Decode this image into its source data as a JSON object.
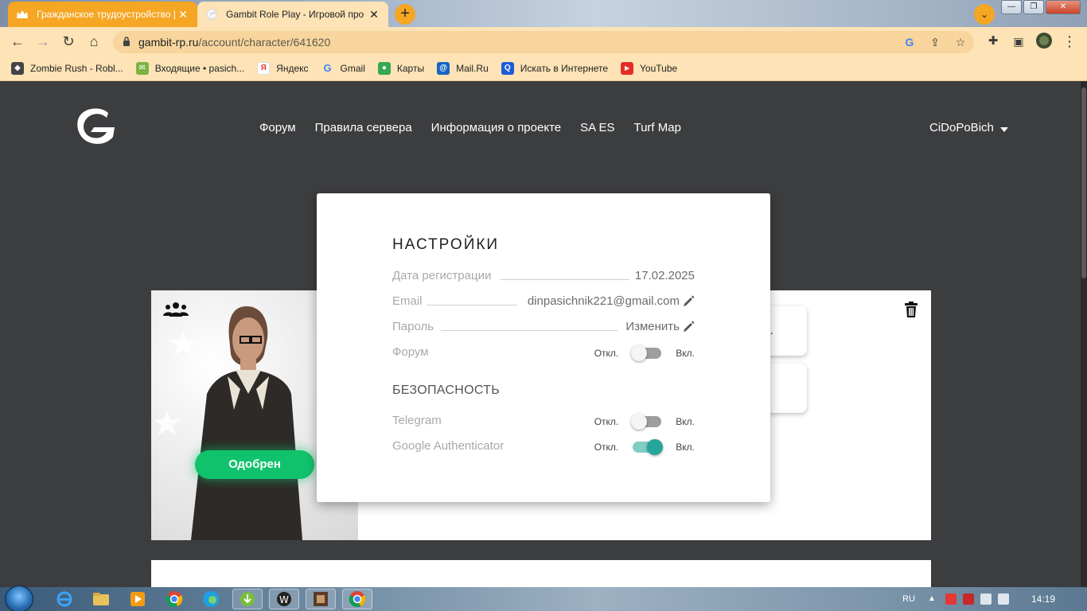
{
  "browser": {
    "tabs": [
      {
        "title": "Гражданское трудоустройство |",
        "active": false
      },
      {
        "title": "Gambit Role Play - Игровой про",
        "active": true
      }
    ],
    "new_tab_label": "+",
    "url_host": "gambit-rp.ru",
    "url_path": "/account/character/641620",
    "bookmarks": [
      {
        "label": "Zombie Rush - Robl...",
        "icon": "roblox-icon",
        "color": "#444444"
      },
      {
        "label": "Входящие • pasich...",
        "icon": "mail-envelope-icon",
        "color": "#7cb342"
      },
      {
        "label": "Яндекс",
        "icon": "yandex-icon",
        "color": "#e53935"
      },
      {
        "label": "Gmail",
        "icon": "google-icon",
        "color": "#4285f4"
      },
      {
        "label": "Карты",
        "icon": "maps-pin-icon",
        "color": "#34a853"
      },
      {
        "label": "Mail.Ru",
        "icon": "mailru-icon",
        "color": "#1565c0"
      },
      {
        "label": "Искать в Интернете",
        "icon": "search-icon",
        "color": "#1e5bd8"
      },
      {
        "label": "YouTube",
        "icon": "youtube-icon",
        "color": "#e52d27"
      }
    ]
  },
  "site": {
    "nav": [
      "Форум",
      "Правила сервера",
      "Информация о проекте",
      "SA ES",
      "Turf Map"
    ],
    "username": "CiDoPoBich"
  },
  "character": {
    "status": "Одобрен",
    "side_text": "l..."
  },
  "settings": {
    "title": "НАСТРОЙКИ",
    "registration": {
      "label": "Дата регистрации",
      "value": "17.02.2025"
    },
    "email": {
      "label": "Email",
      "value": "dinpasichnik221@gmail.com"
    },
    "password": {
      "label": "Пароль",
      "action": "Изменить"
    },
    "forum": {
      "label": "Форум",
      "off": "Откл.",
      "on": "Вкл.",
      "enabled": false
    },
    "security_title": "БЕЗОПАСНОСТЬ",
    "telegram": {
      "label": "Telegram",
      "off": "Откл.",
      "on": "Вкл.",
      "enabled": false
    },
    "google_auth": {
      "label": "Google Authenticator",
      "off": "Откл.",
      "on": "Вкл.",
      "enabled": true
    }
  },
  "taskbar": {
    "language": "RU",
    "time": "14:19"
  },
  "colors": {
    "page_bg": "#3c3d3f",
    "accent_green": "#11c26d",
    "toggle_on": "#26a69a",
    "chrome_tab": "#f5a623",
    "chrome_toolbar": "#fde3b5"
  }
}
